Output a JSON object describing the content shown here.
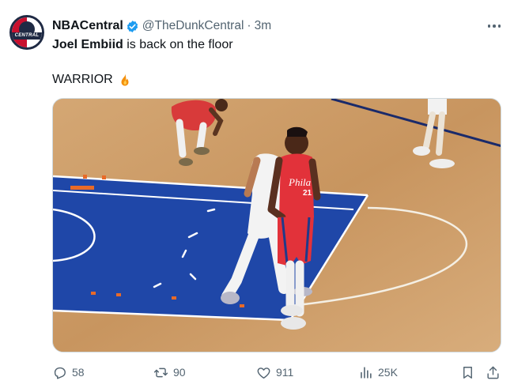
{
  "tweet": {
    "display_name": "NBACentral",
    "handle": "@TheDunkCentral",
    "separator": "·",
    "time": "3m",
    "text_bold": "Joel Embiid",
    "text_rest": " is back on the floor",
    "second_line": "WARRIOR",
    "avatar_text": "CENTRAL"
  },
  "media": {
    "jersey_text": "Phila",
    "jersey_number": "21"
  },
  "actions": {
    "replies": "58",
    "reposts": "90",
    "likes": "911",
    "views": "25K"
  },
  "icons": {
    "verified": "verified-badge-icon",
    "fire": "fire-emoji-icon",
    "reply": "reply-icon",
    "repost": "repost-icon",
    "like": "heart-icon",
    "views": "views-icon",
    "bookmark": "bookmark-icon",
    "share": "share-icon",
    "more": "more-icon"
  },
  "colors": {
    "verified_blue": "#1d9bf0",
    "meta_gray": "#536471",
    "court_blue": "#1f47a8",
    "court_wood": "#c99a67",
    "sixers_red": "#e2323a"
  }
}
